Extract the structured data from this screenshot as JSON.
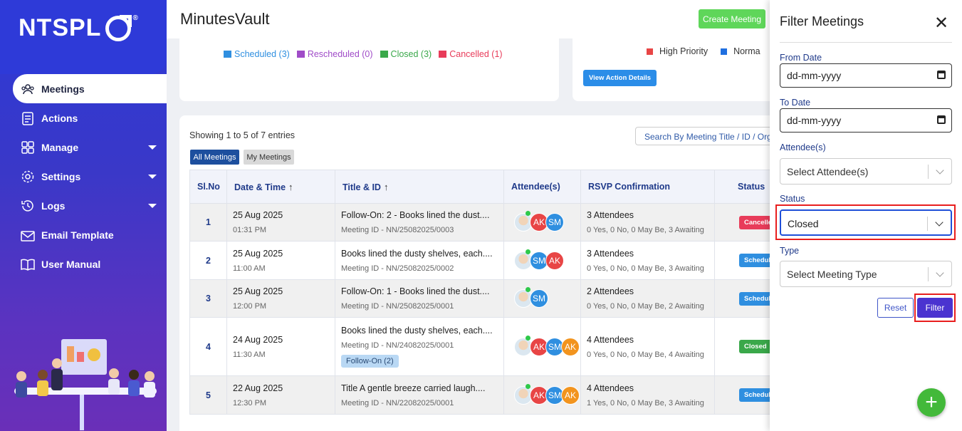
{
  "brand": {
    "logo_text": "NTSPL",
    "trademark": "®"
  },
  "sidebar": {
    "items": [
      {
        "label": "Meetings",
        "icon": "meetings-icon"
      },
      {
        "label": "Actions",
        "icon": "actions-icon"
      },
      {
        "label": "Manage",
        "icon": "manage-icon"
      },
      {
        "label": "Settings",
        "icon": "gear-icon"
      },
      {
        "label": "Logs",
        "icon": "history-icon"
      },
      {
        "label": "Email Template",
        "icon": "envelope-icon"
      },
      {
        "label": "User Manual",
        "icon": "book-icon"
      }
    ]
  },
  "header": {
    "title": "MinutesVault",
    "create_label": "Create Meeting"
  },
  "status_legend": [
    {
      "label": "Scheduled (3)",
      "color": "#2f8fe0"
    },
    {
      "label": "Rescheduled (0)",
      "color": "#a04cc8"
    },
    {
      "label": "Closed (3)",
      "color": "#3aa84a"
    },
    {
      "label": "Cancelled (1)",
      "color": "#e83c5a"
    }
  ],
  "priority_legend": [
    {
      "label": "High Priority",
      "color": "#e84545"
    },
    {
      "label": "Norma",
      "color": "#1f6fe0"
    }
  ],
  "action_card": {
    "view_label": "View Action Details"
  },
  "list": {
    "showing_prefix": "Showing ",
    "showing_from": "1",
    "showing_to_word": " to ",
    "showing_to": "5",
    "showing_of_word": " of ",
    "showing_total": "7",
    "showing_suffix": " entries",
    "search_placeholder": "Search By Meeting Title / ID / Orga",
    "tab_all": "All Meetings",
    "tab_my": "My Meetings",
    "columns": [
      "Sl.No",
      "Date & Time",
      "Title & ID",
      "Attendee(s)",
      "RSVP Confirmation",
      "Status"
    ],
    "rows": [
      {
        "no": "1",
        "date": "25 Aug 2025",
        "time": "01:31 PM",
        "title": "Follow-On: 2 - Books lined the dust....",
        "id": "Meeting ID - NN/25082025/0003",
        "tag": "",
        "avatars": [
          "AK",
          "SM"
        ],
        "rsvp": "3 Attendees",
        "rsvp_detail": "0 Yes, 0 No, 0 May Be, 3 Awaiting",
        "status": "Cancelled",
        "status_color": "#e83c5a"
      },
      {
        "no": "2",
        "date": "25 Aug 2025",
        "time": "11:00 AM",
        "title": "Books lined the dusty shelves, each....",
        "id": "Meeting ID - NN/25082025/0002",
        "tag": "",
        "avatars": [
          "SM",
          "AK"
        ],
        "rsvp": "3 Attendees",
        "rsvp_detail": "0 Yes, 0 No, 0 May Be, 3 Awaiting",
        "status": "Scheduled",
        "status_color": "#2f8fe0"
      },
      {
        "no": "3",
        "date": "25 Aug 2025",
        "time": "12:00 PM",
        "title": "Follow-On: 1 - Books lined the dust....",
        "id": "Meeting ID - NN/25082025/0001",
        "tag": "",
        "avatars": [
          "SM"
        ],
        "rsvp": "2 Attendees",
        "rsvp_detail": "0 Yes, 0 No, 0 May Be, 2 Awaiting",
        "status": "Scheduled",
        "status_color": "#2f8fe0"
      },
      {
        "no": "4",
        "date": "24 Aug 2025",
        "time": "11:30 AM",
        "title": "Books lined the dusty shelves, each....",
        "id": "Meeting ID - NN/24082025/0001",
        "tag": "Follow-On (2)",
        "avatars": [
          "AK",
          "SM",
          "AK"
        ],
        "rsvp": "4 Attendees",
        "rsvp_detail": "0 Yes, 0 No, 0 May Be, 4 Awaiting",
        "status": "Closed",
        "status_color": "#3aa84a"
      },
      {
        "no": "5",
        "date": "22 Aug 2025",
        "time": "12:30 PM",
        "title": "Title A gentle breeze carried laugh....",
        "id": "Meeting ID - NN/22082025/0001",
        "tag": "",
        "avatars": [
          "AK",
          "SM",
          "AK"
        ],
        "rsvp": "4 Attendees",
        "rsvp_detail": "1 Yes, 0 No, 0 May Be, 3 Awaiting",
        "status": "Scheduled",
        "status_color": "#2f8fe0"
      }
    ]
  },
  "filter": {
    "title": "Filter Meetings",
    "from_label": "From Date",
    "from_value": "dd-mm-yyyy",
    "to_label": "To Date",
    "to_value": "dd-mm-yyyy",
    "attendee_label": "Attendee(s)",
    "attendee_placeholder": "Select Attendee(s)",
    "status_label": "Status",
    "status_value": "Closed",
    "type_label": "Type",
    "type_placeholder": "Select Meeting Type",
    "reset_label": "Reset",
    "filter_label": "Filter"
  },
  "avatar_colors": {
    "AK": "#e84545",
    "SM": "#2f8fe0",
    "AK2": "#f2941e"
  }
}
